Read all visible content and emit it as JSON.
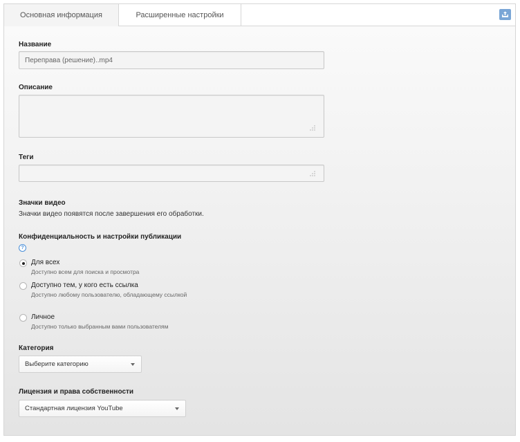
{
  "tabs": {
    "basic_label": "Основная информация",
    "advanced_label": "Расширенные настройки",
    "upload_icon": "upload-icon"
  },
  "title_field": {
    "label": "Название",
    "value": "Переправа (решение)..mp4"
  },
  "description_field": {
    "label": "Описание",
    "value": ""
  },
  "tags_field": {
    "label": "Теги",
    "value": ""
  },
  "thumbnails": {
    "label": "Значки видео",
    "message": "Значки видео появятся после завершения его обработки."
  },
  "privacy": {
    "label": "Конфиденциальность и настройки публикации",
    "help_icon": "?",
    "options": [
      {
        "title": "Для всех",
        "desc": "Доступно всем для поиска и просмотра",
        "checked": true
      },
      {
        "title": "Доступно тем, у кого есть ссылка",
        "desc": "Доступно любому пользователю, обладающему ссылкой",
        "checked": false
      },
      {
        "title": "Личное",
        "desc": "Доступно только выбранным вами пользователям",
        "checked": false
      }
    ]
  },
  "category": {
    "label": "Категория",
    "selected": "Выберите категорию"
  },
  "license": {
    "label": "Лицензия и права собственности",
    "selected": "Стандартная лицензия YouTube"
  },
  "colors": {
    "accent": "#4a8fd8",
    "upload_button": "#7aa6d6"
  }
}
